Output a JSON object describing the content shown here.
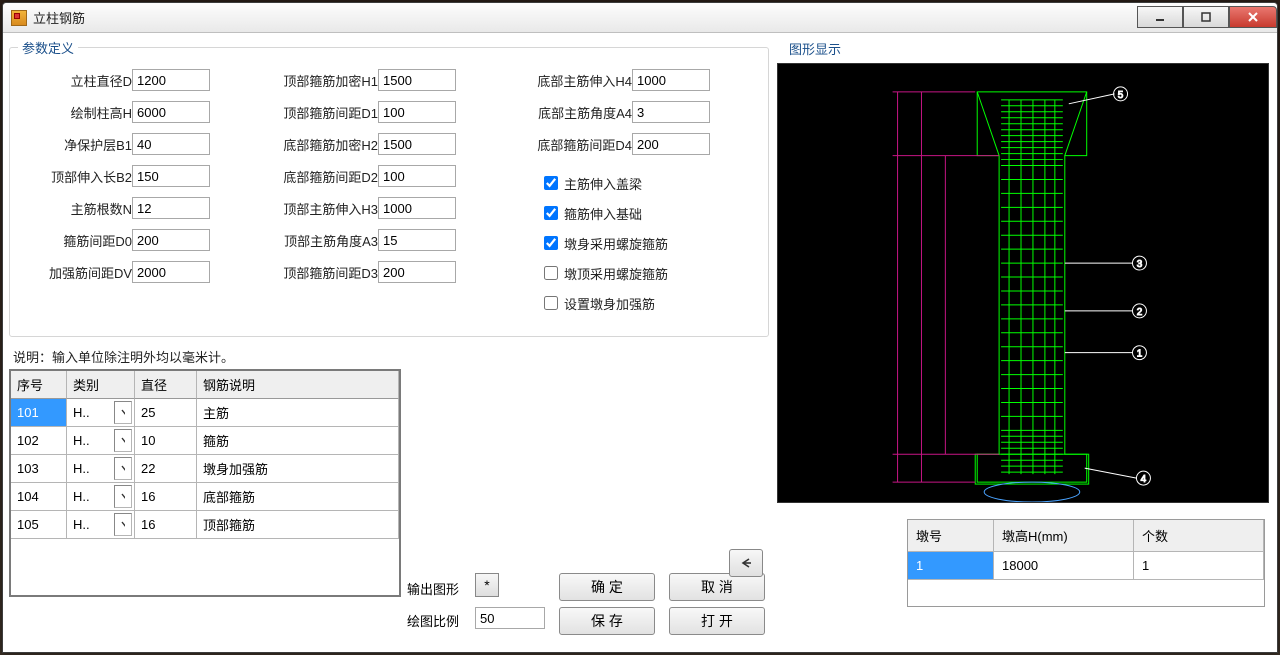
{
  "window": {
    "title": "立柱钢筋"
  },
  "params": {
    "legend": "参数定义",
    "col1": [
      {
        "label": "立柱直径D",
        "value": "1200"
      },
      {
        "label": "绘制柱高H",
        "value": "6000"
      },
      {
        "label": "净保护层B1",
        "value": "40"
      },
      {
        "label": "顶部伸入长B2",
        "value": "150"
      },
      {
        "label": "主筋根数N",
        "value": "12"
      },
      {
        "label": "箍筋间距D0",
        "value": "200"
      },
      {
        "label": "加强筋间距DV",
        "value": "2000"
      }
    ],
    "col2": [
      {
        "label": "顶部箍筋加密H1",
        "value": "1500"
      },
      {
        "label": "顶部箍筋间距D1",
        "value": "100"
      },
      {
        "label": "底部箍筋加密H2",
        "value": "1500"
      },
      {
        "label": "底部箍筋间距D2",
        "value": "100"
      },
      {
        "label": "顶部主筋伸入H3",
        "value": "1000"
      },
      {
        "label": "顶部主筋角度A3",
        "value": "15"
      },
      {
        "label": "顶部箍筋间距D3",
        "value": "200"
      }
    ],
    "col3": [
      {
        "label": "底部主筋伸入H4",
        "value": "1000"
      },
      {
        "label": "底部主筋角度A4",
        "value": "3"
      },
      {
        "label": "底部箍筋间距D4",
        "value": "200"
      }
    ],
    "checks": [
      {
        "label": "主筋伸入盖梁",
        "checked": true
      },
      {
        "label": "箍筋伸入基础",
        "checked": true
      },
      {
        "label": "墩身采用螺旋箍筋",
        "checked": true
      },
      {
        "label": "墩顶采用螺旋箍筋",
        "checked": false
      },
      {
        "label": "设置墩身加强筋",
        "checked": false
      }
    ]
  },
  "note": "说明：输入单位除注明外均以毫米计。",
  "rebarTable": {
    "headers": [
      "序号",
      "类别",
      "直径",
      "钢筋说明"
    ],
    "rows": [
      {
        "seq": "101",
        "cat": "H..",
        "dia": "25",
        "desc": "主筋",
        "sel": true
      },
      {
        "seq": "102",
        "cat": "H..",
        "dia": "10",
        "desc": "箍筋"
      },
      {
        "seq": "103",
        "cat": "H..",
        "dia": "22",
        "desc": "墩身加强筋"
      },
      {
        "seq": "104",
        "cat": "H..",
        "dia": "16",
        "desc": "底部箍筋"
      },
      {
        "seq": "105",
        "cat": "H..",
        "dia": "16",
        "desc": "顶部箍筋"
      }
    ]
  },
  "outputShapeLabel": "输出图形",
  "drawScaleLabel": "绘图比例",
  "drawScaleValue": "50",
  "starLabel": "*",
  "buttons": {
    "ok": "确 定",
    "cancel": "取 消",
    "save": "保 存",
    "open": "打 开"
  },
  "graphicLegend": "图形显示",
  "pierTable": {
    "headers": [
      "墩号",
      "墩高H(mm)",
      "个数"
    ],
    "rows": [
      {
        "no": "1",
        "h": "18000",
        "cnt": "1",
        "sel": true
      }
    ]
  }
}
